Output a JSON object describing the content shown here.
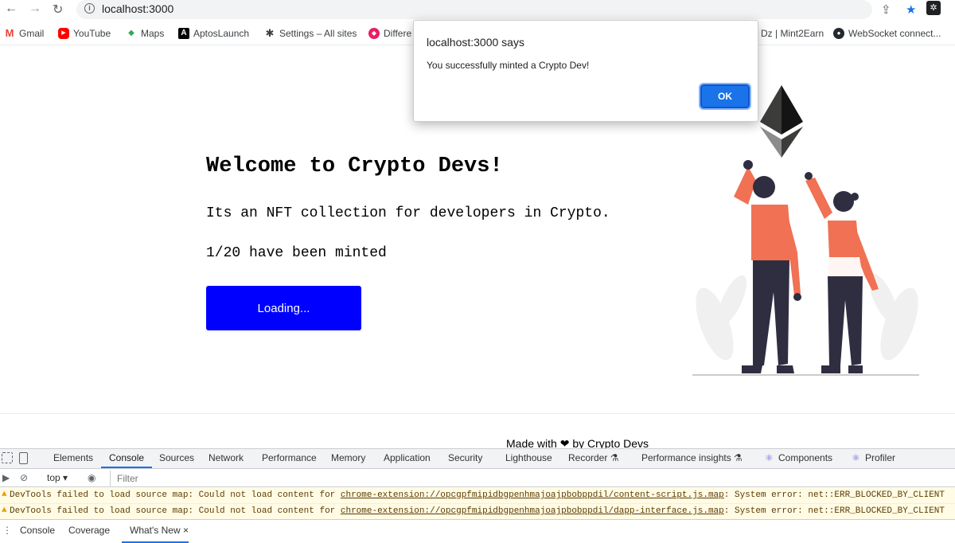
{
  "browser": {
    "url": "localhost:3000",
    "back_icon": "←",
    "forward_icon": "→",
    "reload_icon": "↻"
  },
  "bookmarks": [
    {
      "label": "Gmail",
      "icon": "gmail-icon",
      "color": "#ea4335",
      "glyph": "M"
    },
    {
      "label": "YouTube",
      "icon": "youtube-icon",
      "color": "#ff0000",
      "glyph": "▶"
    },
    {
      "label": "Maps",
      "icon": "maps-icon",
      "color": "#34a853",
      "glyph": "◆"
    },
    {
      "label": "AptosLaunch",
      "icon": "aptos-icon",
      "color": "#000000",
      "glyph": "A"
    },
    {
      "label": "Settings – All sites",
      "icon": "gear-icon",
      "color": "#3c4043",
      "glyph": "✱"
    },
    {
      "label": "Differe",
      "icon": "cube-icon",
      "color": "#e91e63",
      "glyph": "◆"
    },
    {
      "label": "Dz | Mint2Earn",
      "icon": "",
      "color": "",
      "glyph": ""
    },
    {
      "label": "WebSocket connect...",
      "icon": "github-icon",
      "color": "#24292f",
      "glyph": "●"
    }
  ],
  "page": {
    "title": "Welcome to Crypto Devs!",
    "description": "Its an NFT collection for developers in Crypto.",
    "minted_count": "1/20 have been minted",
    "mint_button": "Loading...",
    "footer": "Made with ❤ by Crypto Devs",
    "colors": {
      "button": "#0000ff",
      "accent": "#f07154"
    }
  },
  "dialog": {
    "title": "localhost:3000 says",
    "message": "You successfully minted a Crypto Dev!",
    "ok": "OK"
  },
  "devtools": {
    "tabs": [
      "Elements",
      "Console",
      "Sources",
      "Network",
      "Performance",
      "Memory",
      "Application",
      "Security",
      "Lighthouse",
      "Recorder ⚗",
      "Performance insights ⚗",
      "Components",
      "Profiler"
    ],
    "active_tab": "Console",
    "context": "top ▾",
    "filter_placeholder": "Filter",
    "messages": [
      {
        "prefix": "DevTools failed to load source map: Could not load content for ",
        "link": "chrome-extension://opcgpfmipidbgpenhmajoajpbobppdil/content-script.js.map",
        "suffix": ": System error: net::ERR_BLOCKED_BY_CLIENT"
      },
      {
        "prefix": "DevTools failed to load source map: Could not load content for ",
        "link": "chrome-extension://opcgpfmipidbgpenhmajoajpbobppdil/dapp-interface.js.map",
        "suffix": ": System error: net::ERR_BLOCKED_BY_CLIENT"
      }
    ],
    "drawer_tabs": [
      "Console",
      "Coverage",
      "What's New"
    ],
    "drawer_close": "×"
  }
}
